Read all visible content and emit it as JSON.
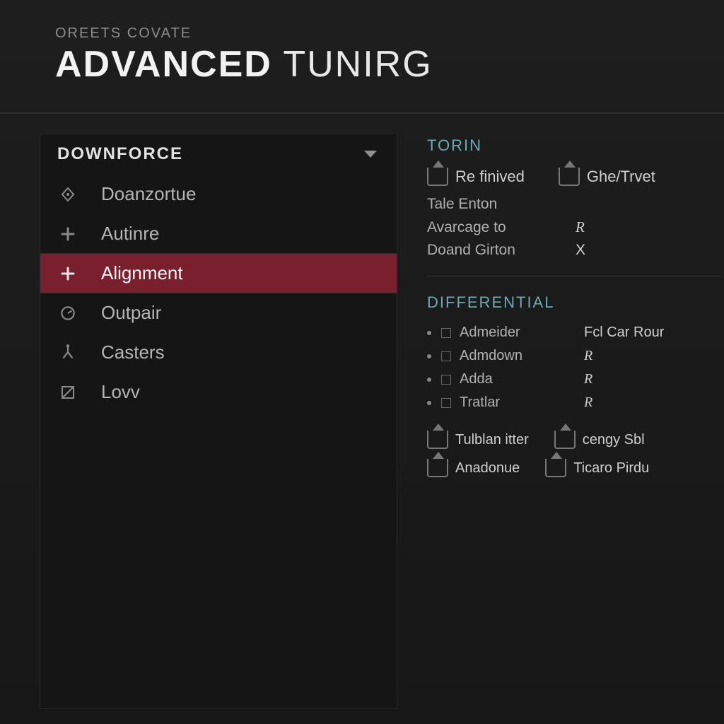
{
  "header": {
    "breadcrumb": "OREETS COVATE",
    "title_bold": "ADVANCED",
    "title_light": " TUNIRG"
  },
  "sidebar": {
    "title": "DOWNFORCE",
    "items": [
      {
        "label": "Doanzortue",
        "selected": false,
        "icon": "diamond"
      },
      {
        "label": "Autinre",
        "selected": false,
        "icon": "plus"
      },
      {
        "label": "Alignment",
        "selected": true,
        "icon": "plus"
      },
      {
        "label": "Outpair",
        "selected": false,
        "icon": "gauge"
      },
      {
        "label": "Casters",
        "selected": false,
        "icon": "split"
      },
      {
        "label": "Lovv",
        "selected": false,
        "icon": "slash"
      }
    ]
  },
  "panel": {
    "torin": {
      "title": "TORIN",
      "chips": [
        {
          "label": "Re finived"
        },
        {
          "label": "Ghe/Trvet"
        }
      ],
      "rows": [
        {
          "k": "Tale Enton",
          "v": ""
        },
        {
          "k": "Avarcage to",
          "v": "R"
        },
        {
          "k": "Doand Girton",
          "v": "X"
        }
      ]
    },
    "differential": {
      "title": "DIFFERENTIAL",
      "items": [
        {
          "label": "Admeider",
          "val": "Fcl Car Rour"
        },
        {
          "label": "Admdown",
          "val": "R"
        },
        {
          "label": "Adda",
          "val": "R"
        },
        {
          "label": "Tratlar",
          "val": "R"
        }
      ],
      "chips": [
        {
          "label": "Tulblan itter"
        },
        {
          "label": "cengy Sbl"
        },
        {
          "label": "Anadonue"
        },
        {
          "label": "Ticaro Pirdu"
        }
      ]
    }
  }
}
